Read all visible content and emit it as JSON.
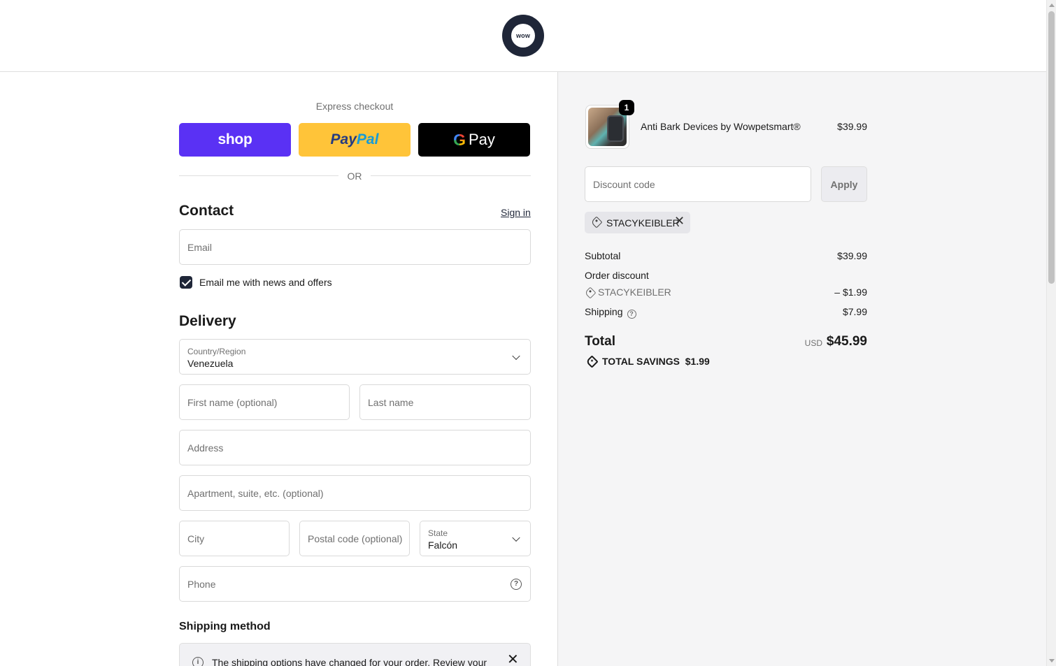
{
  "header": {
    "logo_text": "wow"
  },
  "express": {
    "label": "Express checkout",
    "shop_label": "shop",
    "paypal_part1": "Pay",
    "paypal_part2": "Pal",
    "gpay_g": "G",
    "gpay_label": "Pay",
    "or_label": "OR"
  },
  "contact": {
    "title": "Contact",
    "sign_in": "Sign in",
    "email_placeholder": "Email",
    "newsletter_label": "Email me with news and offers",
    "newsletter_checked": true
  },
  "delivery": {
    "title": "Delivery",
    "country_label": "Country/Region",
    "country_value": "Venezuela",
    "first_name_placeholder": "First name (optional)",
    "last_name_placeholder": "Last name",
    "address_placeholder": "Address",
    "apartment_placeholder": "Apartment, suite, etc. (optional)",
    "city_placeholder": "City",
    "postal_placeholder": "Postal code (optional)",
    "state_label": "State",
    "state_value": "Falcón",
    "phone_placeholder": "Phone"
  },
  "shipping_method": {
    "title": "Shipping method",
    "notice_text": "The shipping options have changed for your order. Review your"
  },
  "summary": {
    "product": {
      "quantity": "1",
      "name": "Anti Bark Devices by Wowpetsmart®",
      "price": "$39.99"
    },
    "discount_placeholder": "Discount code",
    "apply_label": "Apply",
    "applied_code": "STACYKEIBLER",
    "subtotal_label": "Subtotal",
    "subtotal_value": "$39.99",
    "order_discount_label": "Order discount",
    "discount_code": "STACYKEIBLER",
    "discount_value": "– $1.99",
    "shipping_label": "Shipping",
    "shipping_value": "$7.99",
    "total_label": "Total",
    "currency": "USD",
    "total_value": "$45.99",
    "savings_label": "TOTAL SAVINGS",
    "savings_value": "$1.99"
  },
  "icons": {
    "chevron": "chevron-down-icon",
    "help": "question-circle-icon",
    "info": "info-icon",
    "tag": "tag-icon",
    "close": "close-icon"
  },
  "colors": {
    "shop_purple": "#5a31f4",
    "paypal_yellow": "#ffc439",
    "gpay_black": "#000000",
    "brand_navy": "#1f2638",
    "summary_bg": "#f5f5f6"
  }
}
